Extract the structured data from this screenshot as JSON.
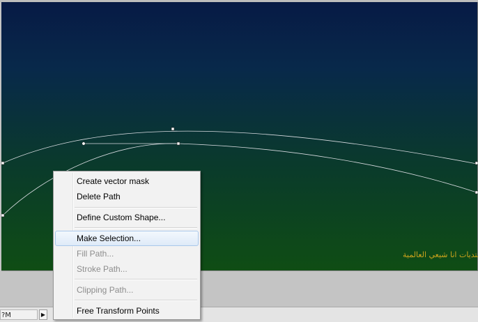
{
  "canvas": {
    "watermark_text": "منتديات انا شيعي العالمية",
    "gradient_top_color": "#071a45",
    "gradient_bottom_color": "#0f4d14",
    "path_stroke_color": "#d8dbe0"
  },
  "status_bar": {
    "zoom_text": "?M",
    "arrow_icon": "play-triangle-icon"
  },
  "context_menu": {
    "items": [
      {
        "label": "Create vector mask",
        "enabled": true
      },
      {
        "label": "Delete Path",
        "enabled": true
      },
      {
        "label": "Define Custom Shape...",
        "enabled": true
      },
      {
        "label": "Make Selection...",
        "enabled": true,
        "highlighted": true
      },
      {
        "label": "Fill Path...",
        "enabled": false
      },
      {
        "label": "Stroke Path...",
        "enabled": false
      },
      {
        "label": "Clipping Path...",
        "enabled": false
      },
      {
        "label": "Free Transform Points",
        "enabled": true
      }
    ],
    "highlight_color": "#deeaf8"
  }
}
